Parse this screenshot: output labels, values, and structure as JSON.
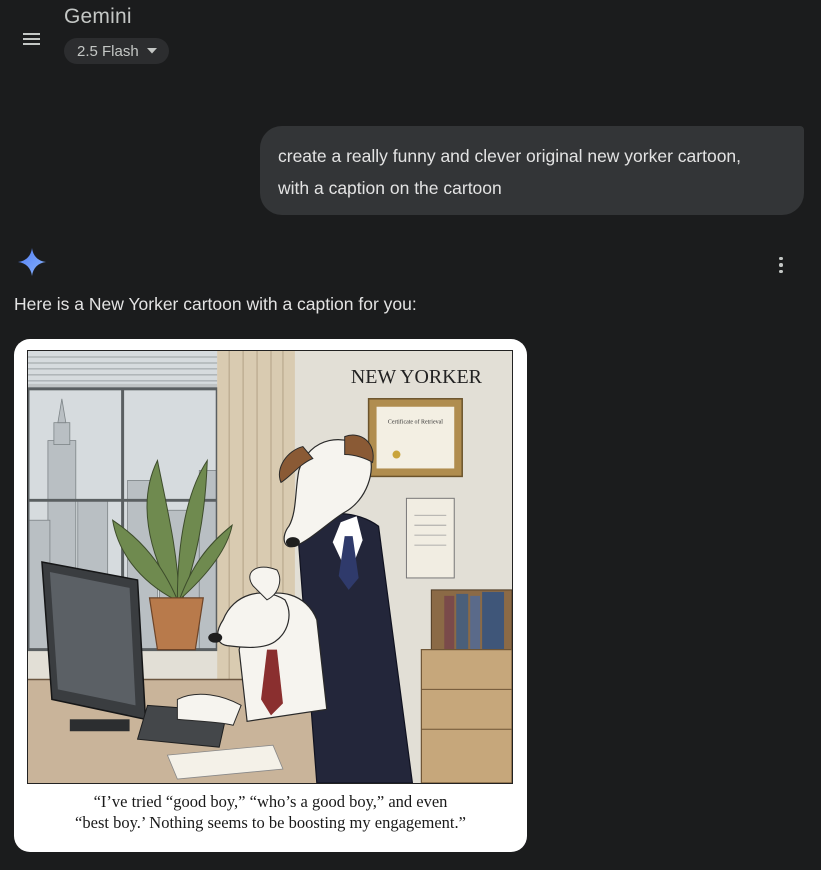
{
  "header": {
    "menu_icon": "hamburger-menu-icon",
    "app_title": "Gemini",
    "model_label": "2.5 Flash",
    "model_dropdown_icon": "caret-down-icon"
  },
  "conversation": {
    "user_message": {
      "line1": "create a really funny and clever original new yorker cartoon,",
      "line2": "with a caption on the cartoon"
    },
    "response": {
      "avatar_icon": "gemini-spark-icon",
      "more_options_icon": "more-vert-icon",
      "text": "Here is a New Yorker cartoon with a caption for you:",
      "image": {
        "magazine_label": "NEW YORKER",
        "certificate_title": "Certificate of Retrieval",
        "caption_line1": "“I’ve tried “good boy,” “who’s a good boy,” and even",
        "caption_line2": "“best boy.’ Nothing seems to be boosting my engagement.”"
      }
    }
  },
  "colors": {
    "background": "#1b1c1d",
    "user_bubble": "#333537",
    "chip": "#2c2d2f",
    "text": "#e3e3e3",
    "muted_text": "#c4c7c5",
    "spark_gradient": [
      "#4f7cf7",
      "#8ab4f8"
    ]
  }
}
